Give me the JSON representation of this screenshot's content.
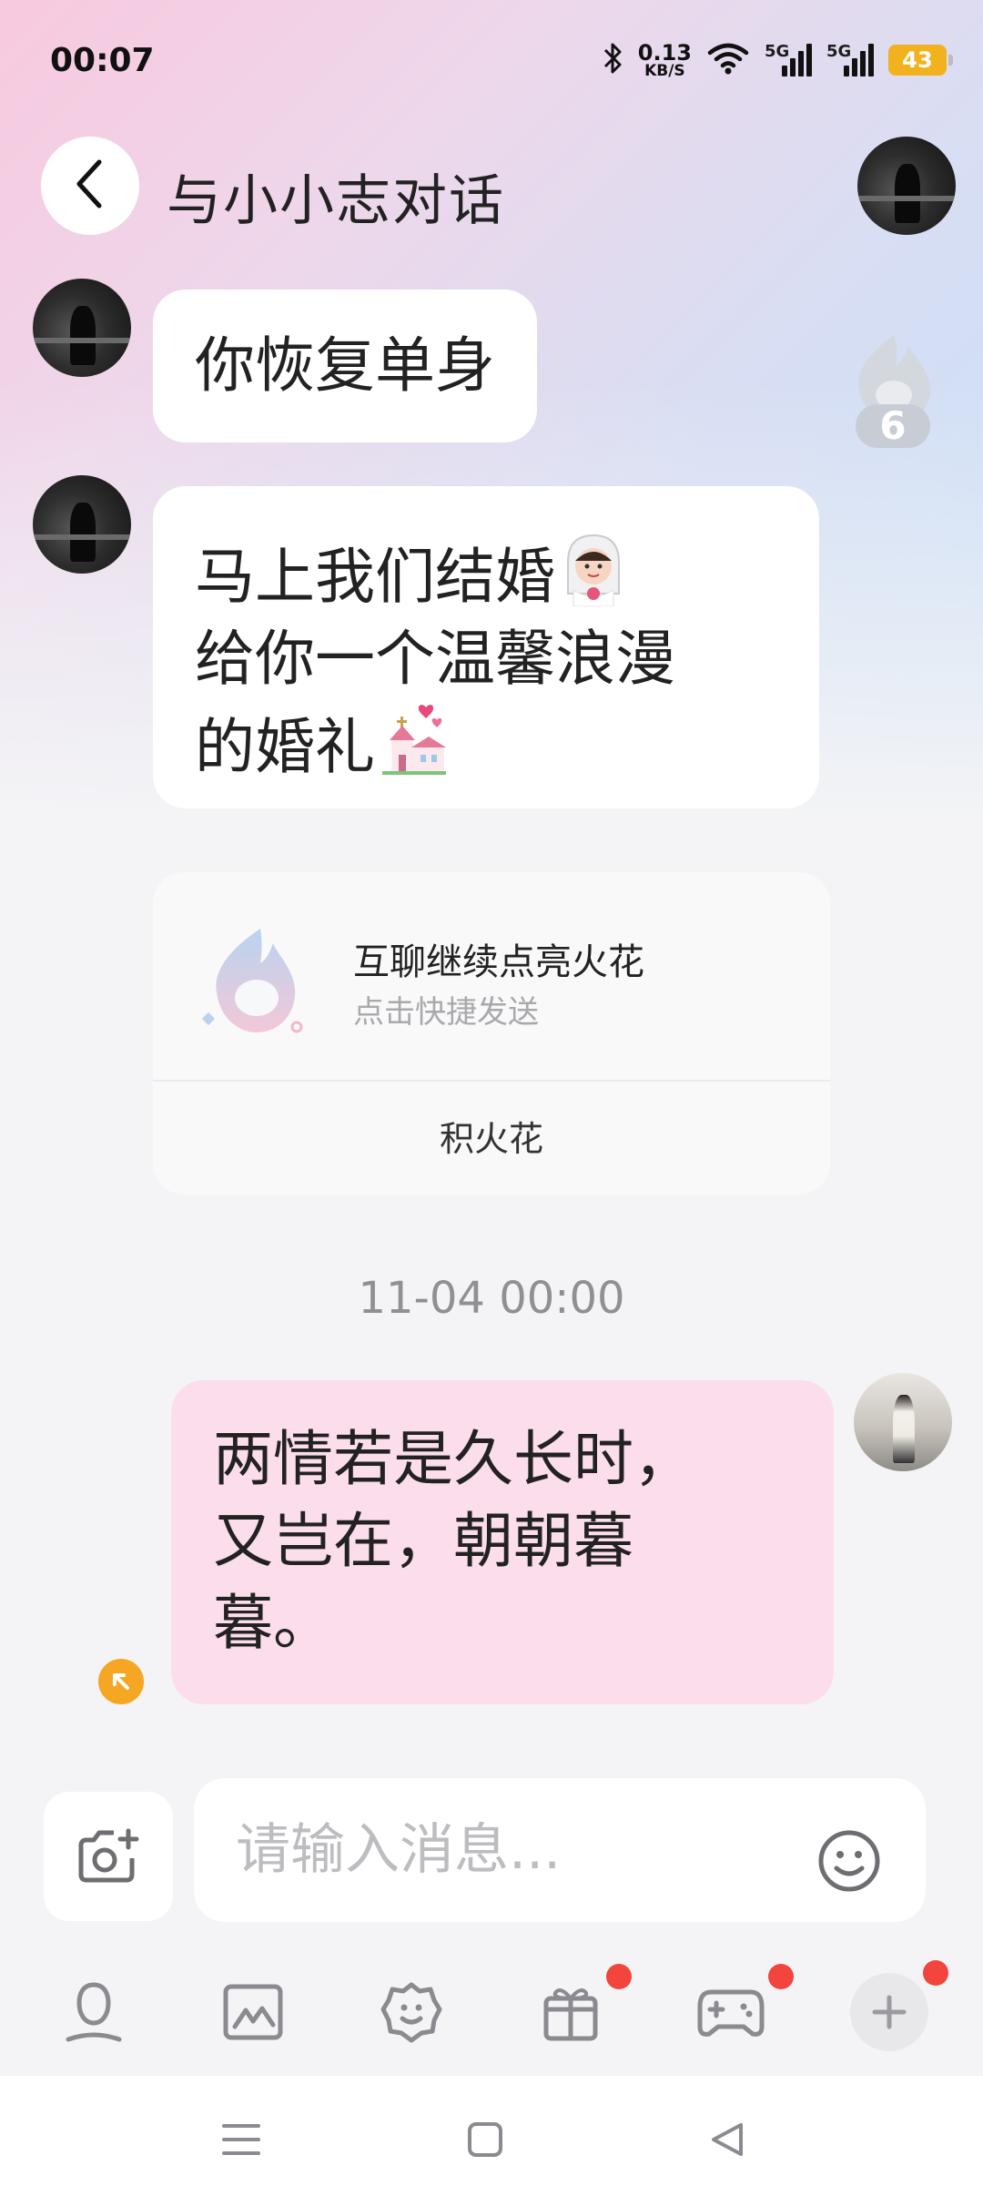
{
  "status_bar": {
    "time": "00:07",
    "net_speed_value": "0.13",
    "net_speed_unit": "KB/S",
    "signal_1_label": "5G",
    "signal_2_label": "5G",
    "battery": "43"
  },
  "header": {
    "title": "与小小志对话"
  },
  "spark_badge": {
    "count": "6"
  },
  "messages": [
    {
      "direction": "incoming",
      "lines": [
        "你恢复单身"
      ]
    },
    {
      "direction": "incoming",
      "lines": [
        "马上我们结婚",
        "给你一个温馨浪漫",
        "的婚礼"
      ]
    },
    {
      "direction": "outgoing",
      "lines": [
        "两情若是久长时，",
        "又岂在，朝朝暮",
        "暮。"
      ]
    }
  ],
  "spark_card": {
    "title": "互聊继续点亮火花",
    "subtitle": "点击快捷发送",
    "action": "积火花"
  },
  "timestamp": "11-04 00:00",
  "input": {
    "placeholder": "请输入消息..."
  },
  "toolbar": [
    {
      "icon": "microphone-icon",
      "badge": false
    },
    {
      "icon": "image-icon",
      "badge": false
    },
    {
      "icon": "sticker-icon",
      "badge": false
    },
    {
      "icon": "gift-icon",
      "badge": true
    },
    {
      "icon": "gamepad-icon",
      "badge": true
    },
    {
      "icon": "plus-icon",
      "badge": true
    }
  ],
  "colors": {
    "outgoing_bubble": "#fbddec",
    "badge_red": "#f2453d",
    "battery": "#f2b21d"
  }
}
